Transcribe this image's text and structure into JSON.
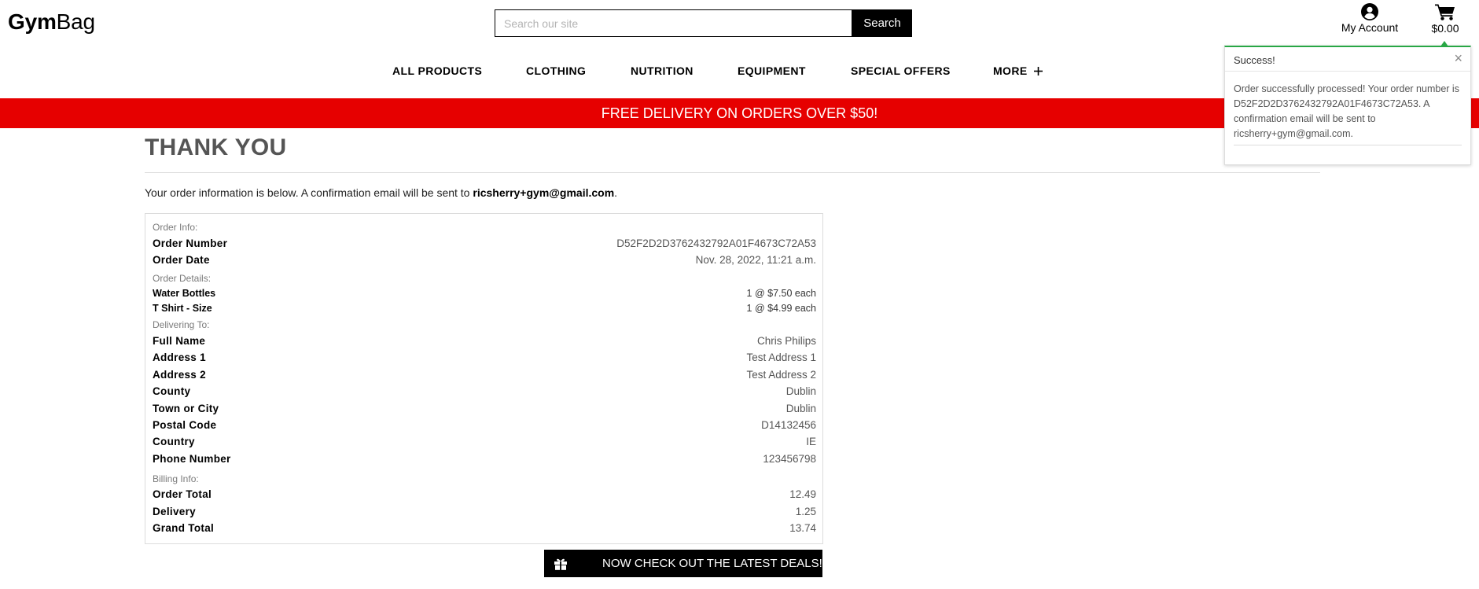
{
  "header": {
    "logo_bold": "Gym",
    "logo_regular": "Bag",
    "search_placeholder": "Search our site",
    "search_button": "Search",
    "account_label": "My Account",
    "cart_total": "$0.00"
  },
  "nav": {
    "items": [
      "ALL PRODUCTS",
      "CLOTHING",
      "NUTRITION",
      "EQUIPMENT",
      "SPECIAL OFFERS",
      "MORE"
    ],
    "more_icon": "plus-icon"
  },
  "banner": {
    "text": "FREE DELIVERY ON ORDERS OVER $50!",
    "color": "#e60000"
  },
  "main": {
    "title": "THANK YOU",
    "intro_prefix": "Your order information is below. A confirmation email will be sent to ",
    "email": "ricsherry+gym@gmail.com",
    "intro_suffix": "."
  },
  "order": {
    "order_info_heading": "Order Info:",
    "order_number_label": "Order Number",
    "order_number": "D52F2D2D3762432792A01F4673C72A53",
    "order_date_label": "Order Date",
    "order_date": "Nov. 28, 2022, 11:21 a.m.",
    "order_details_heading": "Order Details:",
    "items": [
      {
        "name": "Water Bottles",
        "qty_price": "1 @ $7.50 each"
      },
      {
        "name": "T Shirt - Size",
        "qty_price": "1 @ $4.99 each"
      }
    ],
    "delivering_heading": "Delivering To:",
    "full_name_label": "Full Name",
    "full_name": "Chris Philips",
    "address1_label": "Address 1",
    "address1": "Test Address 1",
    "address2_label": "Address 2",
    "address2": "Test Address 2",
    "county_label": "County",
    "county": "Dublin",
    "town_label": "Town or City",
    "town": "Dublin",
    "postal_label": "Postal Code",
    "postal": "D14132456",
    "country_label": "Country",
    "country": "IE",
    "phone_label": "Phone Number",
    "phone": "123456798",
    "billing_heading": "Billing Info:",
    "order_total_label": "Order Total",
    "order_total": "12.49",
    "delivery_label": "Delivery",
    "delivery": "1.25",
    "grand_total_label": "Grand Total",
    "grand_total": "13.74"
  },
  "deals_button": {
    "label": "NOW CHECK OUT THE LATEST DEALS!",
    "icon": "gift-icon"
  },
  "toast": {
    "title": "Success!",
    "close": "×",
    "message": "Order successfully processed! Your order number is D52F2D2D3762432792A01F4673C72A53. A confirmation email will be sent to ricsherry+gym@gmail.com.",
    "accent_color": "#28a745"
  }
}
